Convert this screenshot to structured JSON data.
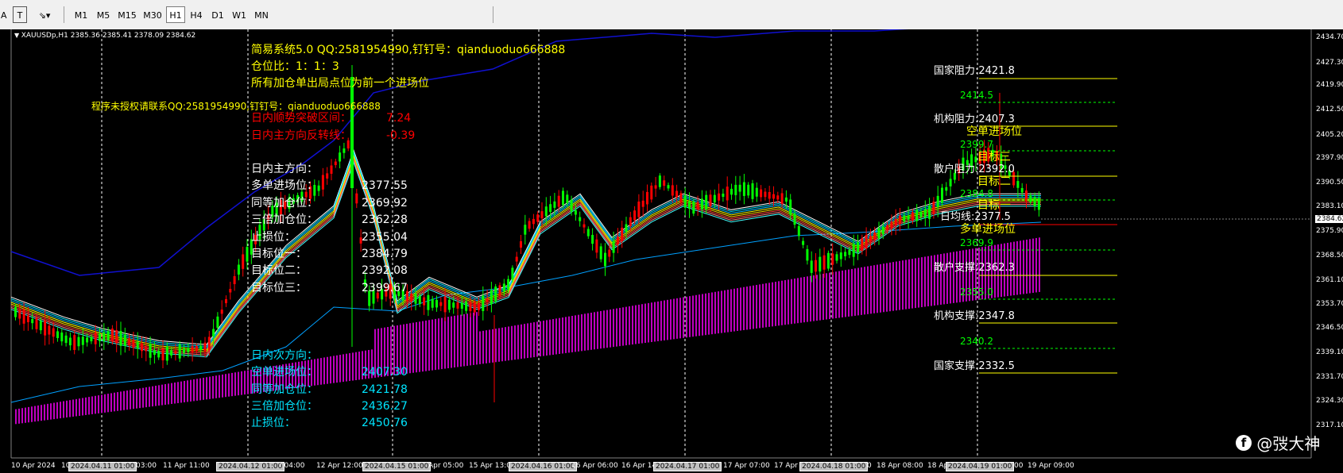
{
  "toolbar": {
    "tools": [
      "A",
      "T",
      "glyph-tool"
    ],
    "timeframes": [
      "M1",
      "M5",
      "M15",
      "M30",
      "H1",
      "H4",
      "D1",
      "W1",
      "MN"
    ],
    "active": "H1"
  },
  "chart": {
    "header": "XAUUSDp,H1  2385.36 2385.41 2378.09 2384.62",
    "current_price": "2384.62",
    "y_ticks": [
      "2434.70",
      "2427.30",
      "2419.90",
      "2412.50",
      "2405.20",
      "2397.90",
      "2390.50",
      "2383.10",
      "2375.90",
      "2368.50",
      "2361.10",
      "2353.70",
      "2346.50",
      "2339.10",
      "2331.70",
      "2324.30",
      "2317.10"
    ],
    "x_labels": [
      "10 Apr 2024",
      "10",
      "2024.04.11 01:00",
      "03:00",
      "11 Apr 11:00",
      "2024.04.12 01:00",
      "r 04:00",
      "12 Apr 12:00",
      "2024.04.15 01:00",
      "Apr 05:00",
      "15 Apr 13:00",
      "2024.04.16 01:00",
      "16 Apr 06:00",
      "16 Apr 14",
      "2024.04.17 01:00",
      "17 Apr 07:00",
      "17 Apr",
      "2024.04.18 01:00",
      "0",
      "18 Apr 08:00",
      "18 Ap",
      "2024.04.19 01:00",
      "00",
      "19 Apr 09:00"
    ],
    "overlay": {
      "sys_title": "简易系统5.0 QQ:2581954990,钉钉号：qianduoduo666888",
      "ratio": "仓位比：1：1：3",
      "add_rule": "所有加仓单出局点位为前一个进场位",
      "license": "程序未授权请联系QQ:2581954990,钉钉号：qianduoduo666888",
      "breakout_label": "日内顺势突破区间：",
      "breakout_value": "7.24",
      "reverse_label": "日内主方向反转线：",
      "reverse_value": "-0.39",
      "main_dir": "日内主方向：",
      "long_entry_label": "多单进场位：",
      "long_entry": "2377.55",
      "equal_add_label": "同等加仓位：",
      "equal_add": "2369.92",
      "triple_add_label": "三倍加仓位：",
      "triple_add": "2362.28",
      "stop_label": "止损位：",
      "stop": "2355.04",
      "target1_label": "目标位一：",
      "target1": "2384.79",
      "target2_label": "目标位二：",
      "target2": "2392.08",
      "target3_label": "目标位三：",
      "target3": "2399.67",
      "second_dir": "日内次方向：",
      "short_entry_label": "空单进场位：",
      "short_entry": "2407.30",
      "s_equal_add_label": "同等加仓位：",
      "s_equal_add": "2421.78",
      "s_triple_add_label": "三倍加仓位：",
      "s_triple_add": "2436.27",
      "s_stop_label": "止损位：",
      "s_stop": "2450.76"
    },
    "levels": {
      "national_res": "国家阻力:2421.8",
      "g1": "2414.5",
      "inst_res": "机构阻力:2407.3",
      "short_entry_tag": "空单进场位",
      "g2": "2399.7",
      "target3_tag": "目标三",
      "retail_res": "散户阻力:2392.0",
      "target2_tag": "目标二",
      "g3": "2384.8",
      "target1_tag": "目标一",
      "daily_avg": "日均线:2377.5",
      "long_entry_tag": "多单进场位",
      "g4": "2369.9",
      "retail_sup": "散户支撑:2362.3",
      "g5": "2355.0",
      "inst_sup": "机构支撑:2347.8",
      "g6": "2340.2",
      "national_sup": "国家支撑:2332.5"
    },
    "watermark": "@弢大神",
    "colors": {
      "bull": "#00ff00",
      "bear": "#ff0000",
      "cloud": "#ff00ff",
      "band": "#1010d0"
    }
  }
}
